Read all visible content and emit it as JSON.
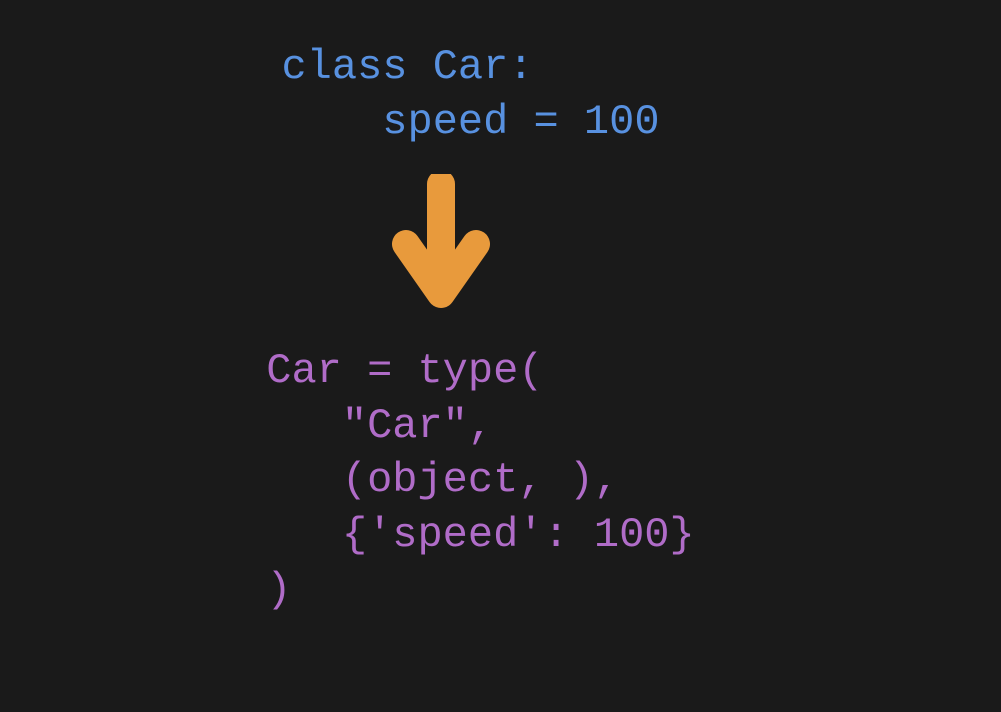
{
  "code_top": {
    "line1": "class Car:",
    "line2": "    speed = 100"
  },
  "code_bottom": {
    "line1": "Car = type(",
    "line2": "   \"Car\",",
    "line3": "   (object, ),",
    "line4": "   {'speed': 100}",
    "line5": ")"
  },
  "arrow_color": "#e89a3c"
}
